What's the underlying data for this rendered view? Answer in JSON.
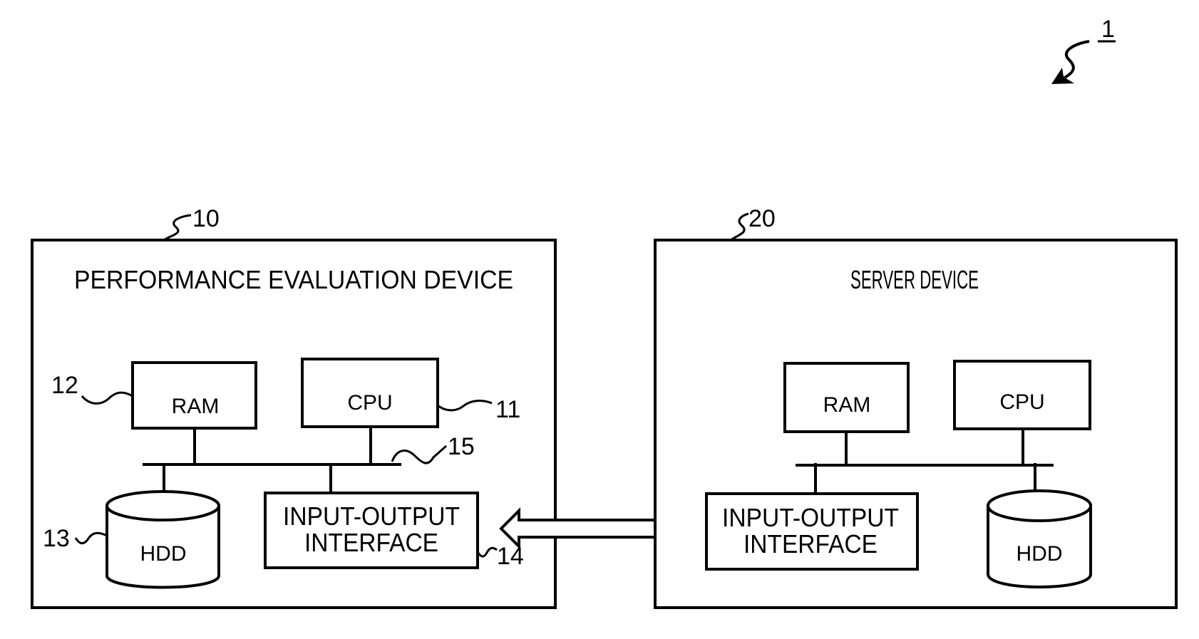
{
  "figure": {
    "system_ref": "1",
    "devices": [
      {
        "ref": "10",
        "title": "PERFORMANCE EVALUATION DEVICE",
        "components": {
          "ram": {
            "label": "RAM",
            "ref": "12"
          },
          "cpu": {
            "label": "CPU",
            "ref": "11"
          },
          "bus": {
            "ref": "15"
          },
          "hdd": {
            "label": "HDD",
            "ref": "13"
          },
          "io": {
            "label_line1": "INPUT-OUTPUT",
            "label_line2": "INTERFACE",
            "ref": "14"
          }
        }
      },
      {
        "ref": "20",
        "title": "SERVER DEVICE",
        "components": {
          "ram": {
            "label": "RAM"
          },
          "cpu": {
            "label": "CPU"
          },
          "hdd": {
            "label": "HDD"
          },
          "io": {
            "label_line1": "INPUT-OUTPUT",
            "label_line2": "INTERFACE"
          }
        }
      }
    ],
    "connection": "bidirectional"
  }
}
